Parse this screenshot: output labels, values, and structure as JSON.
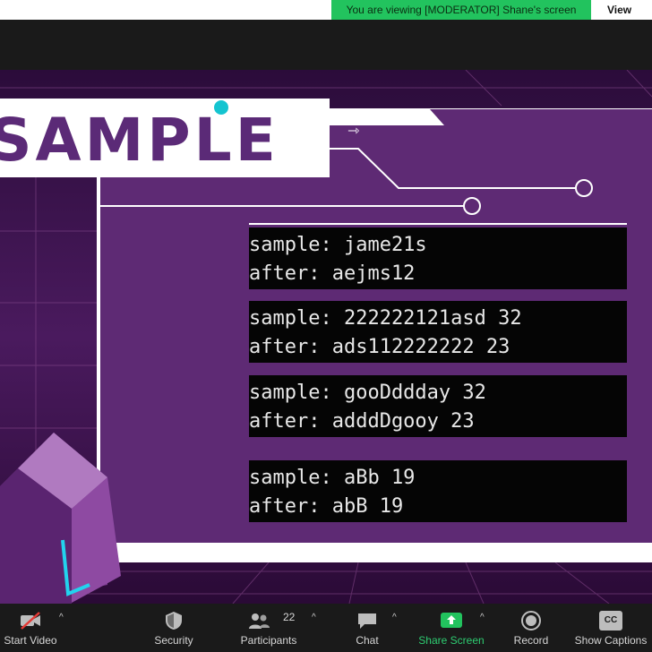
{
  "banner": {
    "viewing_text": "You are viewing [MODERATOR] Shane's screen",
    "view_options": "View Options"
  },
  "slide": {
    "title": "SAMPLE",
    "examples": [
      {
        "sample": "sample: jame21s",
        "after": "after: aejms12"
      },
      {
        "sample": "sample: 222222121asd 32",
        "after": "after: ads112222222 23"
      },
      {
        "sample": "sample: gooDddday 32",
        "after": "after: adddDgooy 23"
      },
      {
        "sample": "sample: aBb 19",
        "after": "after: abB 19"
      }
    ]
  },
  "toolbar": {
    "start_video": "Start Video",
    "security": "Security",
    "participants": "Participants",
    "participants_count": "22",
    "chat": "Chat",
    "share_screen": "Share Screen",
    "record": "Record",
    "show_captions": "Show Captions",
    "cc_badge": "CC"
  },
  "colors": {
    "slide_purple": "#5e2a74",
    "share_green": "#22c35e",
    "accent_cyan": "#14c4d0"
  }
}
